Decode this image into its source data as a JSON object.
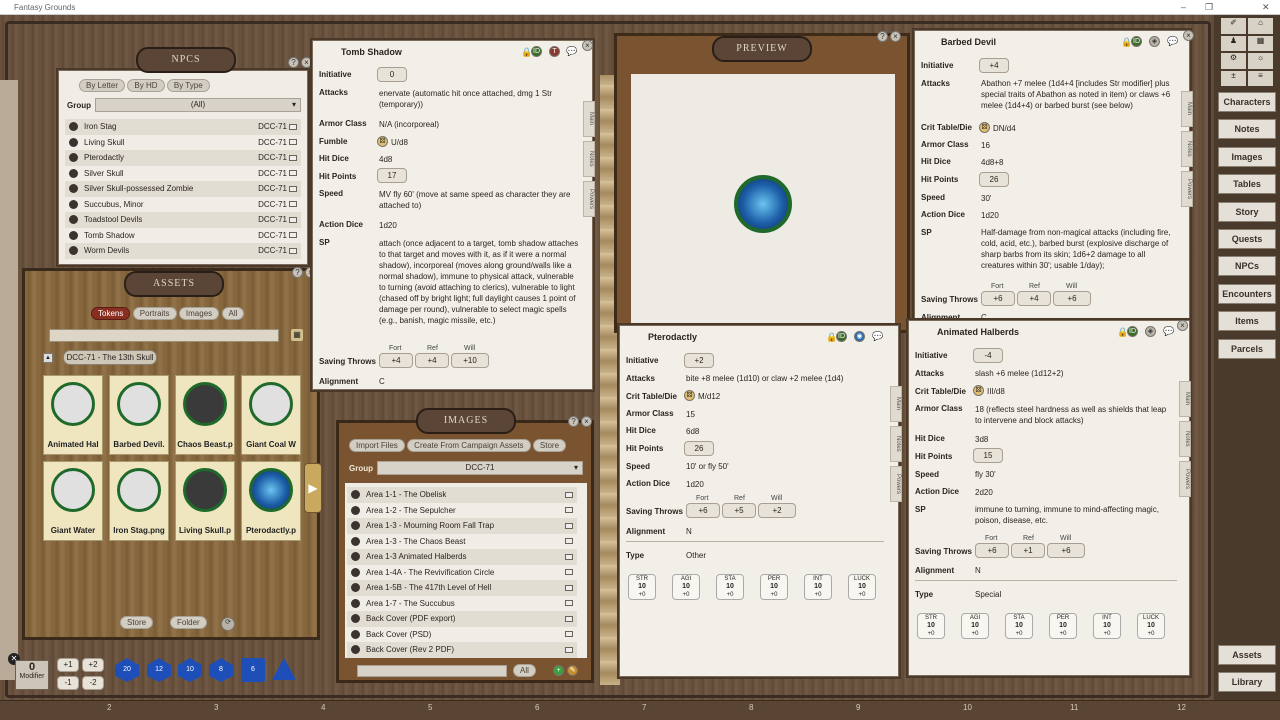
{
  "window": {
    "title": "Fantasy Grounds",
    "min": "–",
    "max": "❐",
    "close": "✕"
  },
  "npcs": {
    "title": "NPCS",
    "filters": [
      "By Letter",
      "By HD",
      "By Type"
    ],
    "group_label": "Group",
    "group_value": "(All)",
    "items": [
      {
        "name": "Iron Stag",
        "src": "DCC-71"
      },
      {
        "name": "Living Skull",
        "src": "DCC-71"
      },
      {
        "name": "Pterodactly",
        "src": "DCC-71"
      },
      {
        "name": "Silver Skull",
        "src": "DCC-71"
      },
      {
        "name": "Silver Skull-possessed Zombie",
        "src": "DCC-71"
      },
      {
        "name": "Succubus, Minor",
        "src": "DCC-71"
      },
      {
        "name": "Toadstool Devils",
        "src": "DCC-71"
      },
      {
        "name": "Tomb Shadow",
        "src": "DCC-71"
      },
      {
        "name": "Worm Devils",
        "src": "DCC-71"
      }
    ]
  },
  "assets": {
    "title": "ASSETS",
    "tabs": [
      "Tokens",
      "Portraits",
      "Images",
      "All"
    ],
    "folder": "DCC-71 - The 13th Skull",
    "tokens": [
      "Animated Hal",
      "Barbed Devil.",
      "Chaos Beast.p",
      "Giant Coal W",
      "Giant Water",
      "Iron Stag.png",
      "Living Skull.p",
      "Pterodactly.p"
    ],
    "store": "Store",
    "folder_btn": "Folder"
  },
  "tomb": {
    "title": "Tomb Shadow",
    "initiative": "0",
    "attacks": "enervate (automatic hit once attached, dmg 1 Str (temporary))",
    "armor": "N/A (incorporeal)",
    "fumble": "U/d8",
    "hitdice": "4d8",
    "hp": "17",
    "speed": "MV fly 60' (move at same speed as character they are attached to)",
    "action": "1d20",
    "sp": "attach (once adjacent to a target, tomb shadow attaches to that target and moves with it, as if it were a normal shadow), incorporeal (moves along ground/walls like a normal shadow), immune to physical attack, vulnerable to turning (avoid attaching to clerics), vulnerable to light (chased off by bright light; full daylight causes 1 point of damage per round), vulnerable to select magic spells (e.g., banish, magic missile, etc.)",
    "fort": "+4",
    "ref": "+4",
    "will": "+10",
    "alignment": "C"
  },
  "labels": {
    "initiative": "Initiative",
    "attacks": "Attacks",
    "armor": "Armor Class",
    "fumble": "Fumble",
    "crit": "Crit Table/Die",
    "hitdice": "Hit Dice",
    "hp": "Hit Points",
    "speed": "Speed",
    "action": "Action Dice",
    "sp": "SP",
    "saves": "Saving Throws",
    "fort": "Fort",
    "ref": "Ref",
    "will": "Will",
    "alignment": "Alignment",
    "type": "Type",
    "main": "Main",
    "notes": "Notes",
    "powers": "Powers"
  },
  "preview": {
    "title": "PREVIEW"
  },
  "barbed": {
    "title": "Barbed Devil",
    "initiative": "+4",
    "attacks": "Abathon +7 melee (1d4+4 [includes Str modifier] plus special traits of Abathon as noted in item) or claws +6 melee (1d4+4) or barbed burst (see below)",
    "crit": "DN/d4",
    "armor": "16",
    "hitdice": "4d8+8",
    "hp": "26",
    "speed": "30'",
    "action": "1d20",
    "sp": "Half-damage from non-magical attacks (including fire, cold, acid, etc.), barbed burst (explosive discharge of sharp barbs from its skin; 1d6+2 damage to all creatures within 30'; usable 1/day);",
    "fort": "+6",
    "ref": "+4",
    "will": "+6",
    "alignment": "C"
  },
  "ptero": {
    "title": "Pterodactly",
    "initiative": "+2",
    "attacks": "bite +8 melee (1d10) or claw +2 melee (1d4)",
    "crit": "M/d12",
    "armor": "15",
    "hitdice": "6d8",
    "hp": "26",
    "speed": "10' or fly 50'",
    "action": "1d20",
    "fort": "+6",
    "ref": "+5",
    "will": "+2",
    "alignment": "N",
    "type": "Other",
    "stats": [
      {
        "k": "STR",
        "v": "10",
        "m": "+0"
      },
      {
        "k": "AGI",
        "v": "10",
        "m": "+0"
      },
      {
        "k": "STA",
        "v": "10",
        "m": "+0"
      },
      {
        "k": "PER",
        "v": "10",
        "m": "+0"
      },
      {
        "k": "INT",
        "v": "10",
        "m": "+0"
      },
      {
        "k": "LUCK",
        "v": "10",
        "m": "+0"
      }
    ]
  },
  "halberd": {
    "title": "Animated Halberds",
    "initiative": "-4",
    "attacks": "slash +6 melee (1d12+2)",
    "crit": "III/d8",
    "armor": "18 (reflects steel hardness as well as shields that leap to intervene and block attacks)",
    "hitdice": "3d8",
    "hp": "15",
    "speed": "fly 30'",
    "action": "2d20",
    "sp": "immune to turning, immune to mind-affecting magic, poison, disease, etc.",
    "fort": "+6",
    "ref": "+1",
    "will": "+6",
    "alignment": "N",
    "type": "Special",
    "stats": [
      {
        "k": "STR",
        "v": "10",
        "m": "+0"
      },
      {
        "k": "AGI",
        "v": "10",
        "m": "+0"
      },
      {
        "k": "STA",
        "v": "10",
        "m": "+0"
      },
      {
        "k": "PER",
        "v": "10",
        "m": "+0"
      },
      {
        "k": "INT",
        "v": "10",
        "m": "+0"
      },
      {
        "k": "LUCK",
        "v": "10",
        "m": "+0"
      }
    ]
  },
  "images": {
    "title": "IMAGES",
    "buttons": [
      "Import Files",
      "Create From Campaign Assets",
      "Store"
    ],
    "group_label": "Group",
    "group_value": "DCC-71",
    "items": [
      "Area 1-1 - The Obelisk",
      "Area 1-2 - The Sepulcher",
      "Area 1-3 - Mourning Room Fall Trap",
      "Area 1-3 - The Chaos Beast",
      "Area 1-3 Animated Halberds",
      "Area 1-4A - The Revivification Circle",
      "Area 1-5B - The 417th Level of Hell",
      "Area 1-7 - The Succubus",
      "Back Cover (PDF export)",
      "Back Cover (PSD)",
      "Back Cover (Rev 2 PDF)"
    ],
    "all": "All"
  },
  "sidebar": [
    "Characters",
    "Notes",
    "Images",
    "Tables",
    "Story",
    "Quests",
    "NPCs",
    "Encounters",
    "Items",
    "Parcels"
  ],
  "sidebar_bottom": [
    "Assets",
    "Library"
  ],
  "dice": {
    "modifier_value": "0",
    "modifier_label": "Modifier",
    "buttons": [
      "+1",
      "+2",
      "-1",
      "-2"
    ],
    "dice": [
      "20",
      "12",
      "10",
      "8",
      "6"
    ]
  },
  "ruler": [
    "2",
    "3",
    "4",
    "5",
    "6",
    "7",
    "8",
    "9",
    "10",
    "11",
    "12"
  ]
}
